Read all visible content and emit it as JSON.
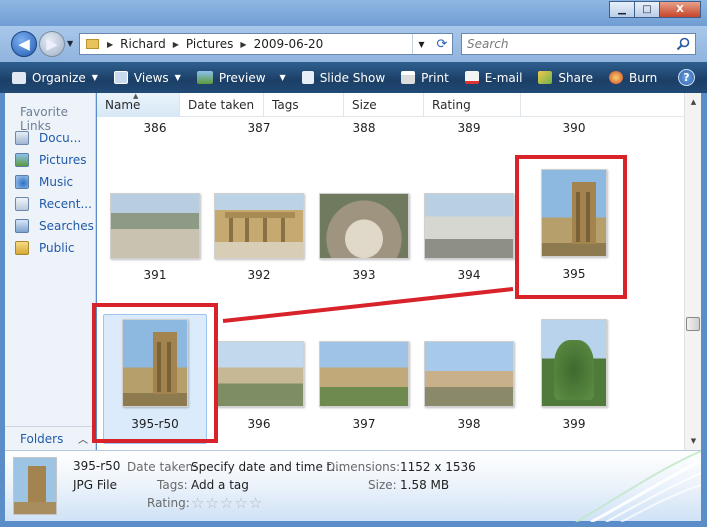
{
  "window": {
    "buttons": {
      "minimize": "▁",
      "maximize": "□",
      "close": "X"
    }
  },
  "address": {
    "crumbs": [
      "Richard",
      "Pictures",
      "2009-06-20"
    ],
    "search_placeholder": "Search"
  },
  "toolbar": {
    "organize": "Organize",
    "views": "Views",
    "preview": "Preview",
    "slideshow": "Slide Show",
    "print": "Print",
    "email": "E-mail",
    "share": "Share",
    "burn": "Burn",
    "help": "?"
  },
  "sidebar": {
    "heading": "Favorite Links",
    "items": [
      {
        "label": "Docu...",
        "icon": "documents-icon"
      },
      {
        "label": "Pictures",
        "icon": "pictures-icon"
      },
      {
        "label": "Music",
        "icon": "music-icon"
      },
      {
        "label": "Recent...",
        "icon": "recent-icon"
      },
      {
        "label": "Searches",
        "icon": "searches-icon"
      },
      {
        "label": "Public",
        "icon": "public-icon"
      }
    ],
    "folders_label": "Folders"
  },
  "columns": [
    "Name",
    "Date taken",
    "Tags",
    "Size",
    "Rating"
  ],
  "files": {
    "top_row": [
      "386",
      "387",
      "388",
      "389",
      "390"
    ],
    "row1": [
      "391",
      "392",
      "393",
      "394",
      "395"
    ],
    "row2": [
      "395-r50",
      "396",
      "397",
      "398",
      "399"
    ]
  },
  "details": {
    "name": "395-r50",
    "type": "JPG File",
    "date_taken_label": "Date taken:",
    "date_taken_value": "Specify date and time t...",
    "tags_label": "Tags:",
    "tags_value": "Add a tag",
    "rating_label": "Rating:",
    "rating_stars": 0,
    "dimensions_label": "Dimensions:",
    "dimensions_value": "1152 x 1536",
    "size_label": "Size:",
    "size_value": "1.58 MB"
  },
  "colors": {
    "annotation": "#d8232a",
    "toolbar": "#214a76",
    "selection": "#dcebfb"
  }
}
